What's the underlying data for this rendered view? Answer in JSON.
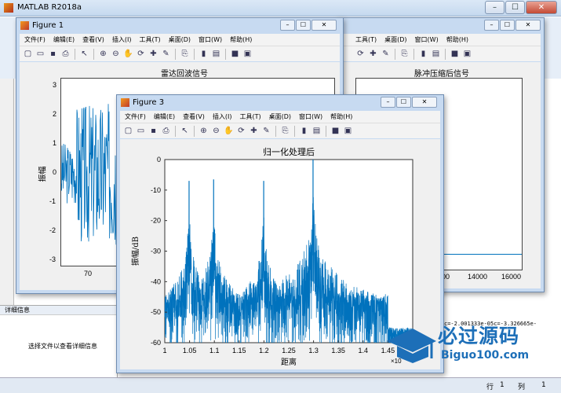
{
  "app": {
    "title": "MATLAB R2018a"
  },
  "bottom_panel": {
    "section_label": "详细信息",
    "message": "选择文件以查看详细信息",
    "status_row": "行",
    "row_value": "1",
    "status_col": "列",
    "col_value": "1",
    "cmd_text": "c=-2.001333e-05c=-3.326665e-"
  },
  "menu": [
    "文件(F)",
    "编辑(E)",
    "查看(V)",
    "插入(I)",
    "工具(T)",
    "桌面(D)",
    "窗口(W)",
    "帮助(H)"
  ],
  "fig1": {
    "title": "Figure 1",
    "plot_title": "雷达回波信号",
    "ylabel": "振幅",
    "yticks": [
      "3",
      "2",
      "1",
      "0",
      "-1",
      "-2",
      "-3"
    ],
    "xticks": [
      "70"
    ]
  },
  "fig2": {
    "plot_title": "脉冲压缩后信号",
    "xticks": [
      "12000",
      "14000",
      "16000"
    ]
  },
  "fig3": {
    "title": "Figure 3"
  },
  "watermark": {
    "big": "必过源码",
    "small": "Biguo100.com"
  },
  "chart_data": [
    {
      "type": "line",
      "title": "归一化处理后",
      "xlabel": "距离",
      "ylabel": "振幅/dB",
      "x_multiplier": "×10",
      "x_exponent": "4",
      "xlim": [
        10000,
        15000
      ],
      "ylim": [
        -60,
        0
      ],
      "xticks": [
        1,
        1.05,
        1.1,
        1.15,
        1.2,
        1.25,
        1.3,
        1.35,
        1.4,
        1.45
      ],
      "yticks": [
        0,
        -10,
        -20,
        -30,
        -40,
        -50,
        -60
      ],
      "peaks": [
        {
          "x": 10490,
          "y": -7
        },
        {
          "x": 10985,
          "y": -6.5
        },
        {
          "x": 11995,
          "y": -7
        },
        {
          "x": 12990,
          "y": 0
        }
      ],
      "series": [
        {
          "color": "#0072BD"
        }
      ]
    },
    {
      "type": "line",
      "title": "雷达回波信号",
      "ylabel": "振幅",
      "ylim": [
        -3,
        3
      ],
      "yticks": [
        3,
        2,
        1,
        0,
        -1,
        -2,
        -3
      ],
      "series": [
        {
          "color": "#0072BD"
        }
      ]
    }
  ]
}
